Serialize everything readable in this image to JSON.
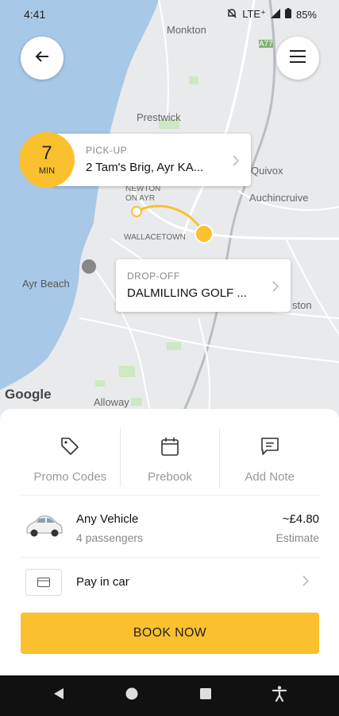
{
  "status_bar": {
    "time": "4:41",
    "network": "LTE⁺",
    "battery": "85%"
  },
  "map": {
    "labels": {
      "monkton": "Monkton",
      "a77": "A77",
      "prestwick": "Prestwick",
      "quivox": "Quivox",
      "auchincruive": "Auchincruive",
      "newton_on_ayr": "NEWTON\nON AYR",
      "wallacetown": "WALLACETOWN",
      "ayr_beach": "Ayr Beach",
      "alloway": "Alloway",
      "ston": "ston",
      "google": "Google"
    }
  },
  "pickup": {
    "eta_value": "7",
    "eta_unit": "MIN",
    "label": "PICK-UP",
    "address": "2 Tam's Brig, Ayr KA..."
  },
  "dropoff": {
    "label": "DROP-OFF",
    "address": "DALMILLING GOLF ..."
  },
  "actions": [
    {
      "label": "Promo Codes",
      "icon": "tag-icon"
    },
    {
      "label": "Prebook",
      "icon": "calendar-icon"
    },
    {
      "label": "Add Note",
      "icon": "note-icon"
    }
  ],
  "vehicle": {
    "name": "Any Vehicle",
    "passengers": "4 passengers",
    "price": "~£4.80",
    "price_note": "Estimate"
  },
  "payment": {
    "method": "Pay in car"
  },
  "book_button": "BOOK NOW",
  "colors": {
    "accent": "#fbc02d",
    "water": "#a8c8e8",
    "map": "#e9eaec"
  }
}
